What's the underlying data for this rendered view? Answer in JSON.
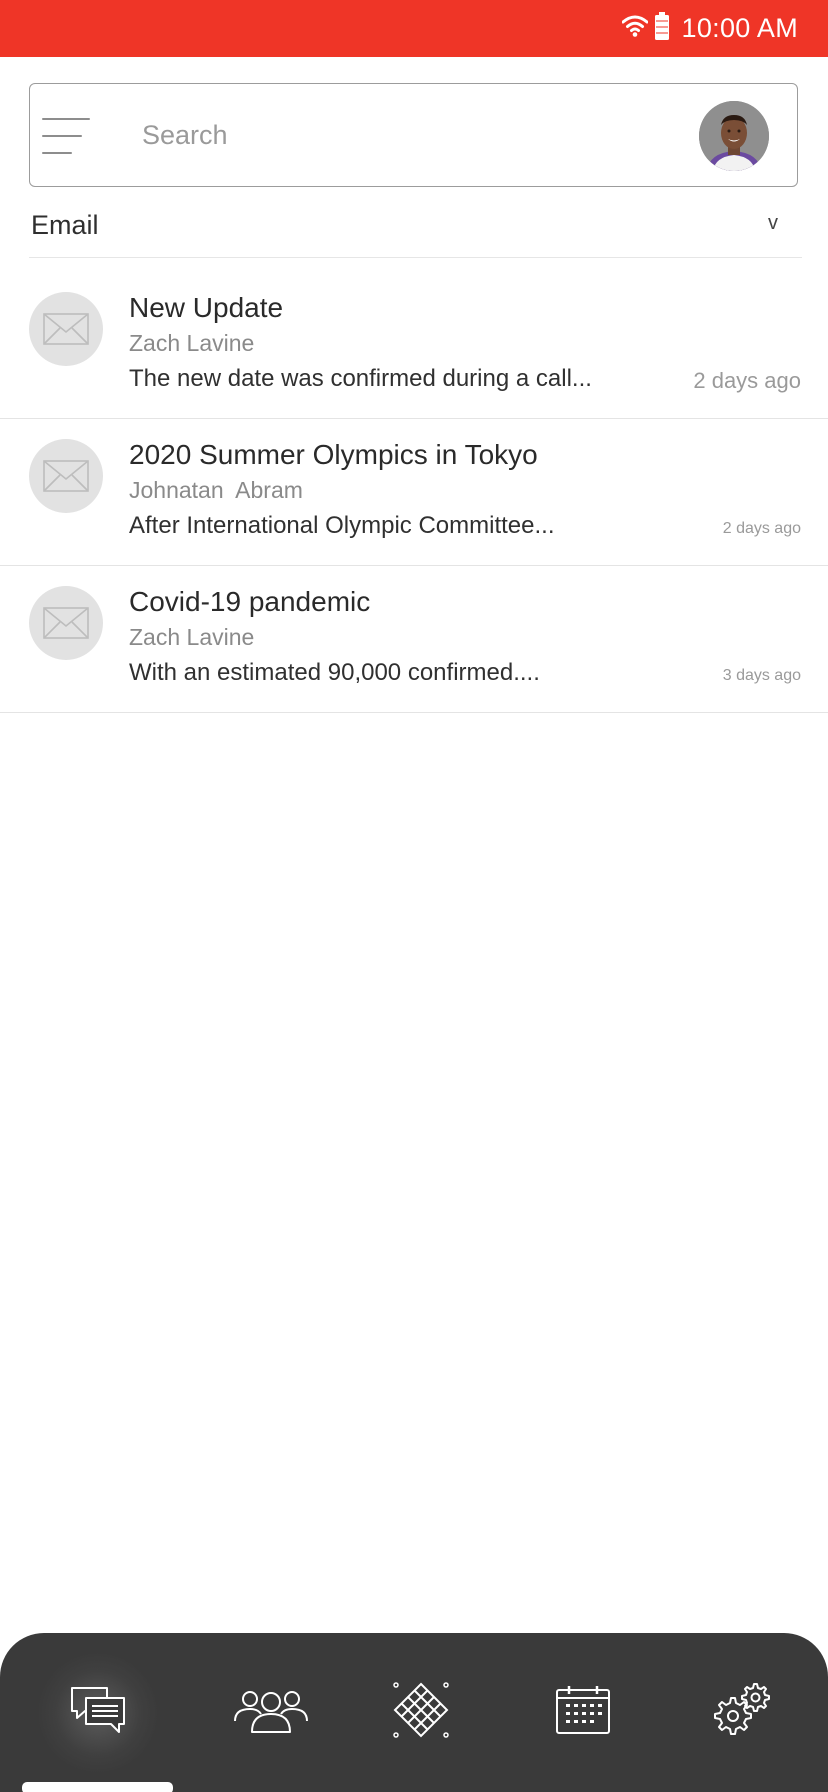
{
  "status_bar": {
    "time": "10:00 AM",
    "background": "#ef3527",
    "icons": [
      "wifi-icon",
      "battery-icon"
    ]
  },
  "search": {
    "placeholder": "Search",
    "menu_icon": "hamburger-menu-icon",
    "avatar": "user-avatar"
  },
  "section": {
    "title": "Email",
    "chevron": "v"
  },
  "emails": [
    {
      "subject": "New Update",
      "sender": "Zach Lavine",
      "preview": "The new date was confirmed during a call...",
      "time": "2 days ago"
    },
    {
      "subject": "2020 Summer Olympics in Tokyo",
      "sender": "Johnatan  Abram",
      "preview": "After International Olympic Committee...",
      "time": "2 days ago"
    },
    {
      "subject": "Covid-19 pandemic",
      "sender": "Zach Lavine",
      "preview": "With an estimated 90,000 confirmed....",
      "time": "3 days ago"
    }
  ],
  "bottom_nav": {
    "items": [
      "chat-icon",
      "people-icon",
      "grid-diamond-icon",
      "calendar-icon",
      "settings-icon"
    ],
    "active": "chat-icon",
    "background": "#3a3a3a"
  }
}
